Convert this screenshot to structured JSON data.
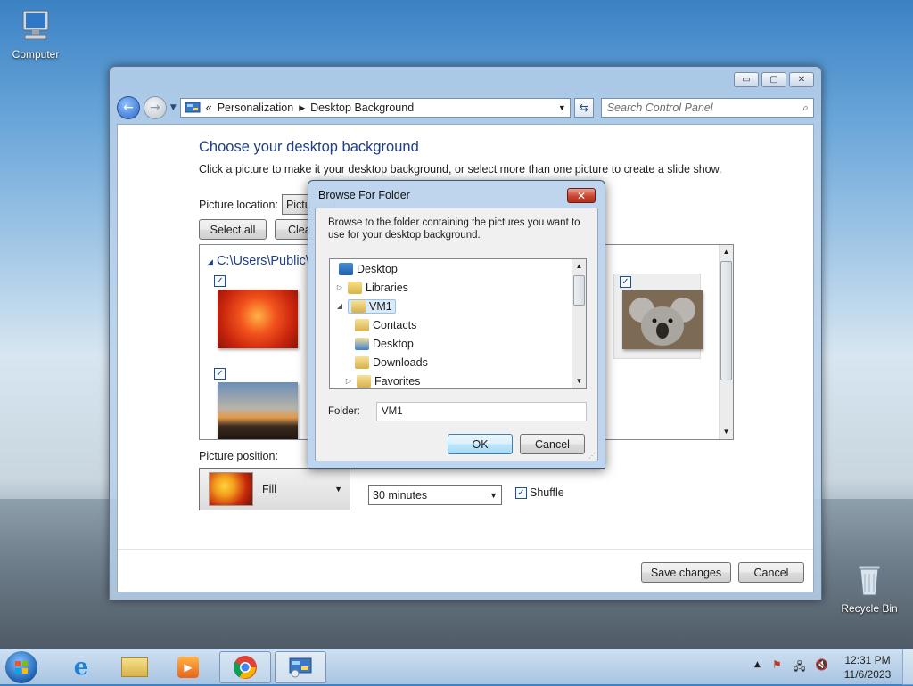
{
  "desktop": {
    "icons": [
      {
        "label": "Computer"
      },
      {
        "label": "Recycle Bin"
      }
    ]
  },
  "window": {
    "controls": {
      "minimize": "▭",
      "maximize": "▢",
      "close": "✕"
    },
    "address": {
      "prefix": "«",
      "crumbs": [
        "Personalization",
        "Desktop Background"
      ]
    },
    "search": {
      "placeholder": "Search Control Panel"
    },
    "heading": "Choose your desktop background",
    "description": "Click a picture to make it your desktop background, or select more than one picture to create a slide show.",
    "picture_location_label": "Picture location:",
    "picture_location_value": "Pictu",
    "select_all": "Select all",
    "clear_all": "Clea",
    "gallery": {
      "path": "C:\\Users\\Public\\",
      "thumbs": [
        {
          "name": "red-flower",
          "checked": true
        },
        {
          "name": "koala",
          "checked": true
        },
        {
          "name": "lighthouse",
          "checked": true
        }
      ]
    },
    "picture_position_label": "Picture position:",
    "picture_position_value": "Fill",
    "interval_value": "30 minutes",
    "shuffle_label": "Shuffle",
    "shuffle_checked": true,
    "save_changes": "Save changes",
    "cancel": "Cancel"
  },
  "dialog": {
    "title": "Browse For Folder",
    "close": "✕",
    "instructions": "Browse to the folder containing the pictures you want to use for your desktop background.",
    "tree": [
      {
        "label": "Desktop",
        "expander": "",
        "icon": "desktop-icon"
      },
      {
        "label": "Libraries",
        "expander": "▷",
        "icon": "libraries-icon"
      },
      {
        "label": "VM1",
        "expander": "◢",
        "icon": "user-folder-icon",
        "selected": true
      },
      {
        "label": "Contacts",
        "expander": "",
        "icon": "contacts-folder-icon"
      },
      {
        "label": "Desktop",
        "expander": "",
        "icon": "desktop-folder-icon"
      },
      {
        "label": "Downloads",
        "expander": "",
        "icon": "downloads-folder-icon"
      },
      {
        "label": "Favorites",
        "expander": "▷",
        "icon": "favorites-folder-icon"
      }
    ],
    "folder_label": "Folder:",
    "folder_value": "VM1",
    "ok": "OK",
    "cancel": "Cancel"
  },
  "taskbar": {
    "clock_time": "12:31 PM",
    "clock_date": "11/6/2023",
    "apps": [
      "start-orb",
      "internet-explorer-icon",
      "file-explorer-icon",
      "media-player-icon",
      "chrome-icon",
      "control-panel-icon"
    ]
  },
  "colors": {
    "heading": "#1e3f87",
    "taskbar": "#b9cfe6",
    "dialog_close": "#c9452f"
  }
}
